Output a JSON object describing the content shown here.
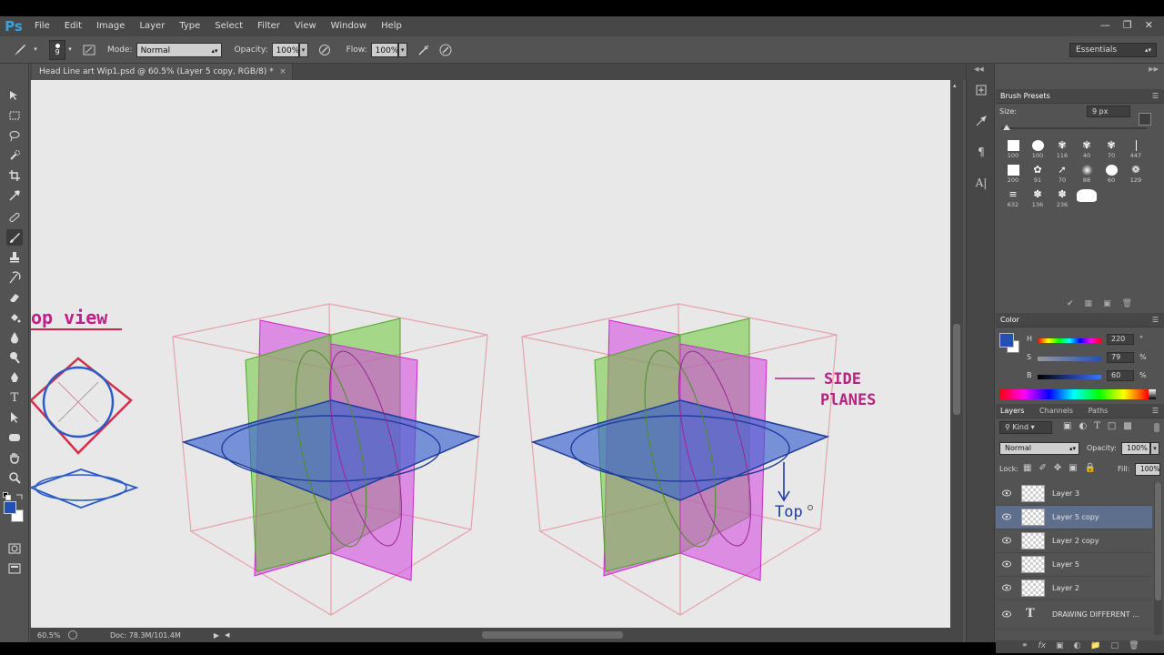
{
  "app": {
    "logo": "Ps"
  },
  "menu": [
    "File",
    "Edit",
    "Image",
    "Layer",
    "Type",
    "Select",
    "Filter",
    "View",
    "Window",
    "Help"
  ],
  "window_controls": [
    "minimize-icon",
    "restore-icon",
    "close-icon"
  ],
  "options": {
    "brush_size": "9",
    "mode_label": "Mode:",
    "mode_value": "Normal",
    "opacity_label": "Opacity:",
    "opacity_value": "100%",
    "flow_label": "Flow:",
    "flow_value": "100%",
    "workspace": "Essentials"
  },
  "document": {
    "tab_title": "Head Line art Wip1.psd @ 60.5% (Layer 5 copy, RGB/8) *",
    "close": "×",
    "zoom": "60.5%",
    "doc_info": "Doc: 78.3M/101.4M"
  },
  "canvas": {
    "label_top_view": "op view",
    "label_side": "SIDE",
    "label_planes": "PlANES",
    "label_top": "Top"
  },
  "brush_presets": {
    "title": "Brush Presets",
    "size_label": "Size:",
    "size_value": "9 px",
    "sizes": [
      "100",
      "100",
      "116",
      "40",
      "70",
      "447",
      "200",
      "91",
      "70",
      "88",
      "60",
      "129",
      "632",
      "136",
      "236",
      ""
    ]
  },
  "color": {
    "title": "Color",
    "h_label": "H",
    "h_value": "220",
    "h_unit": "°",
    "s_label": "S",
    "s_value": "79",
    "s_unit": "%",
    "b_label": "B",
    "b_value": "60",
    "b_unit": "%",
    "foreground": "#2450b4",
    "background": "#ffffff"
  },
  "layers": {
    "tabs": [
      "Layers",
      "Channels",
      "Paths"
    ],
    "filter_value": "Kind",
    "blend_mode": "Normal",
    "opacity_label": "Opacity:",
    "opacity_value": "100%",
    "lock_label": "Lock:",
    "fill_label": "Fill:",
    "fill_value": "100%",
    "items": [
      {
        "name": "Layer 3"
      },
      {
        "name": "Layer 5 copy"
      },
      {
        "name": "Layer 2 copy"
      },
      {
        "name": "Layer 5"
      },
      {
        "name": "Layer 2"
      },
      {
        "name": "DRAWING DIFFERENT ..."
      }
    ]
  }
}
